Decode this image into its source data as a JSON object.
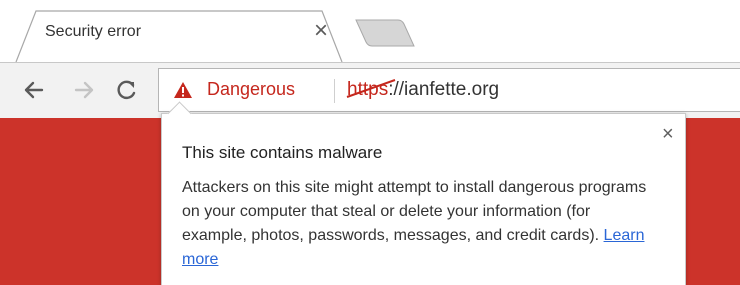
{
  "tab": {
    "title": "Security error",
    "close_glyph": "×"
  },
  "toolbar": {
    "back_icon": "back-arrow-icon",
    "forward_icon": "forward-arrow-icon",
    "reload_icon": "reload-icon"
  },
  "omnibox": {
    "security_label": "Dangerous",
    "url_scheme": "https",
    "url_rest": "://ianfette.org",
    "warning_icon": "warning-triangle-icon"
  },
  "bubble": {
    "close_glyph": "×",
    "title": "This site contains malware",
    "body": "Attackers on this site might attempt to install dangerous programs on your computer that steal or delete your information (for example, photos, passwords, messages, and credit cards).",
    "link": "Learn more"
  },
  "colors": {
    "danger_red": "#c5271d",
    "page_red": "#cc332a",
    "link_blue": "#2a66d6"
  }
}
